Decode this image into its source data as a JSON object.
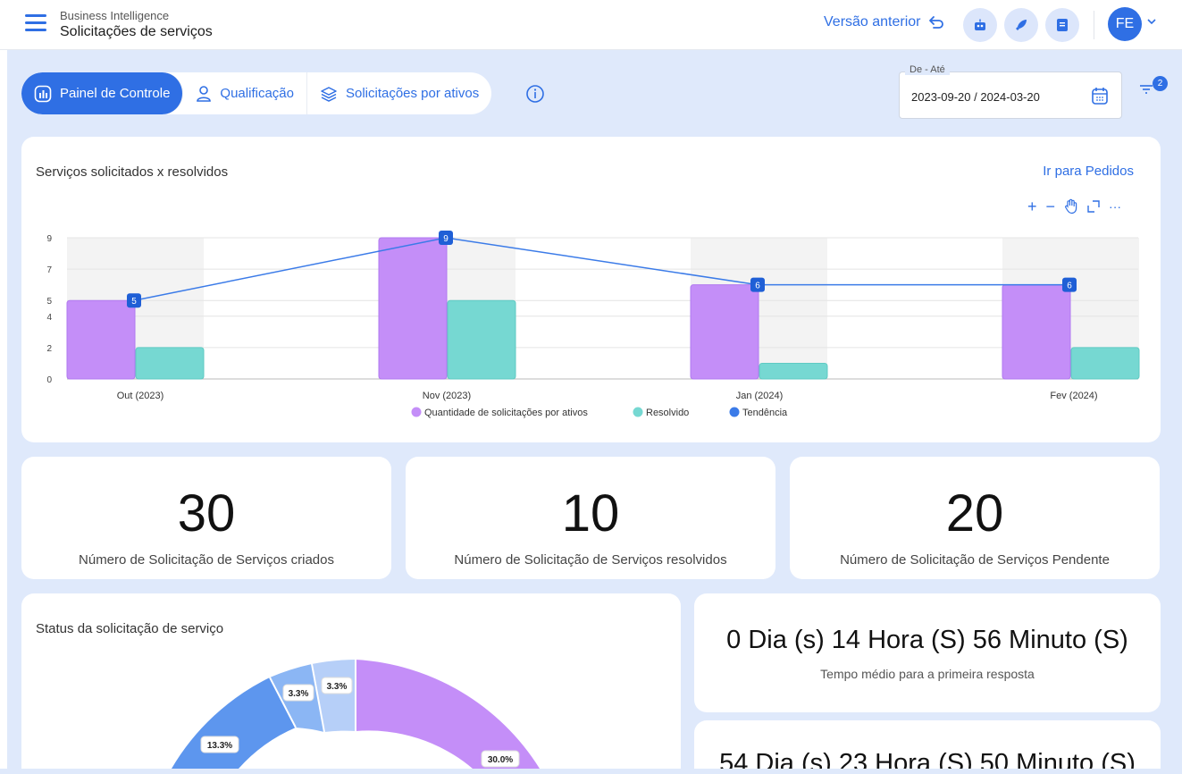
{
  "header": {
    "breadcrumb": "Business Intelligence",
    "title": "Solicitações de serviços",
    "previous_version": "Versão anterior",
    "avatar_initials": "FE"
  },
  "tabs": [
    {
      "label": "Painel de Controle",
      "icon": "bar-chart-icon",
      "active": true
    },
    {
      "label": "Qualificação",
      "icon": "user-icon",
      "active": false
    },
    {
      "label": "Solicitações por ativos",
      "icon": "layers-icon",
      "active": false
    }
  ],
  "date_filter": {
    "label": "De - Até",
    "value": "2023-09-20 / 2024-03-20"
  },
  "filter_badge": "2",
  "chart_card": {
    "title": "Serviços solicitados x resolvidos",
    "link": "Ir para Pedidos"
  },
  "chart_data": {
    "type": "bar",
    "categories": [
      "Out (2023)",
      "Nov (2023)",
      "Jan (2024)",
      "Fev (2024)"
    ],
    "series": [
      {
        "name": "Quantidade de solicitações por ativos",
        "type": "bar",
        "color": "#c48ef8",
        "values": [
          5,
          9,
          6,
          6
        ]
      },
      {
        "name": "Resolvido",
        "type": "bar",
        "color": "#76d8d2",
        "values": [
          2,
          5,
          1,
          2
        ]
      },
      {
        "name": "Tendência",
        "type": "line",
        "color": "#3b7be8",
        "values": [
          5,
          9,
          6,
          6
        ]
      }
    ],
    "y_ticks": [
      "0",
      "2",
      "4",
      "5",
      "7",
      "9"
    ],
    "ylim": [
      0,
      9
    ],
    "grid": true,
    "legend_position": "bottom"
  },
  "stats": [
    {
      "value": "30",
      "label": "Número de Solicitação de Serviços criados"
    },
    {
      "value": "10",
      "label": "Número de Solicitação de Serviços resolvidos"
    },
    {
      "value": "20",
      "label": "Número de Solicitação de Serviços Pendente"
    }
  ],
  "status_card": {
    "title": "Status da solicitação de serviço",
    "donut_labels": [
      "30.0%",
      "13.3%",
      "3.3%",
      "3.3%"
    ],
    "colors": [
      "#c48ef8",
      "#5d96ee",
      "#8bb6f4",
      "#b6cff8"
    ]
  },
  "times": [
    {
      "value": "0 Dia (s) 14 Hora (S) 56 Minuto (S)",
      "label": "Tempo médio para a primeira resposta"
    },
    {
      "value": "54 Dia (s) 23 Hora (S) 50 Minuto (S)",
      "label": ""
    }
  ]
}
